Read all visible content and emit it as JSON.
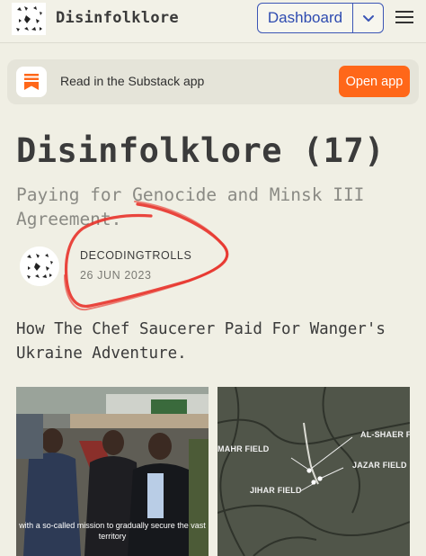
{
  "header": {
    "brand": "Disinfolklore",
    "dashboard_label": "Dashboard"
  },
  "banner": {
    "text": "Read in the Substack app",
    "open_label": "Open app"
  },
  "post": {
    "title": "Disinfolklore (17)",
    "subtitle": "Paying for Genocide and Minsk III Agreement.",
    "author": "DECODINGTROLLS",
    "date": "26 JUN 2023",
    "lede": "How The Chef Saucerer Paid For Wanger's Ukraine Adventure."
  },
  "images": {
    "left_caption": "with a so-called mission to gradually secure the vast territory",
    "map_labels": {
      "al_shaer": "AL-SHAER FIELD",
      "mahr": "MAHR FIELD",
      "jazar": "JAZAR FIELD",
      "jihar": "JIHAR FIELD"
    }
  },
  "colors": {
    "background": "#f0efe4",
    "accent_blue": "#3b55b5",
    "substack_orange": "#ff6719",
    "annotation_red": "#e8322a"
  }
}
